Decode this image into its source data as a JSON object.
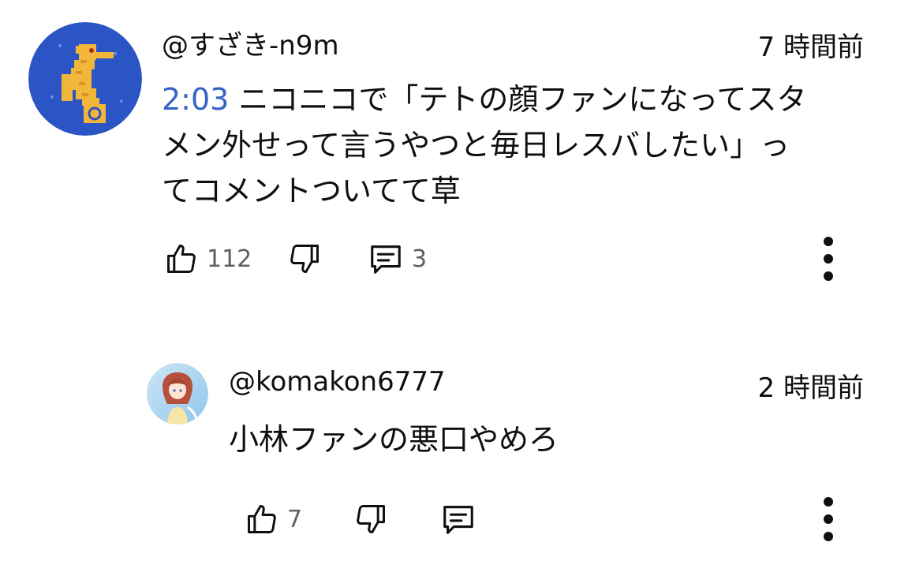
{
  "comments": [
    {
      "handle": "@すざき-n9m",
      "time": "7 時間前",
      "timestamp": "2:03",
      "line1": " ニコニコで「テトの顔ファンになってスタ",
      "line2": "メン外せって言うやつと毎日レスバしたい」っ",
      "line3": "てコメントついてて草",
      "likes": "112",
      "replies": "3",
      "avatar_icon": "seahorse-icon",
      "avatar_bg": "#2b54c4"
    },
    {
      "handle": "@komakon6777",
      "time": "2 時間前",
      "text": "小林ファンの悪口やめろ",
      "likes": "7",
      "avatar_icon": "anime-character-icon"
    }
  ],
  "colors": {
    "link": "#3462c6",
    "text": "#0f0f0f",
    "muted": "#606060"
  }
}
